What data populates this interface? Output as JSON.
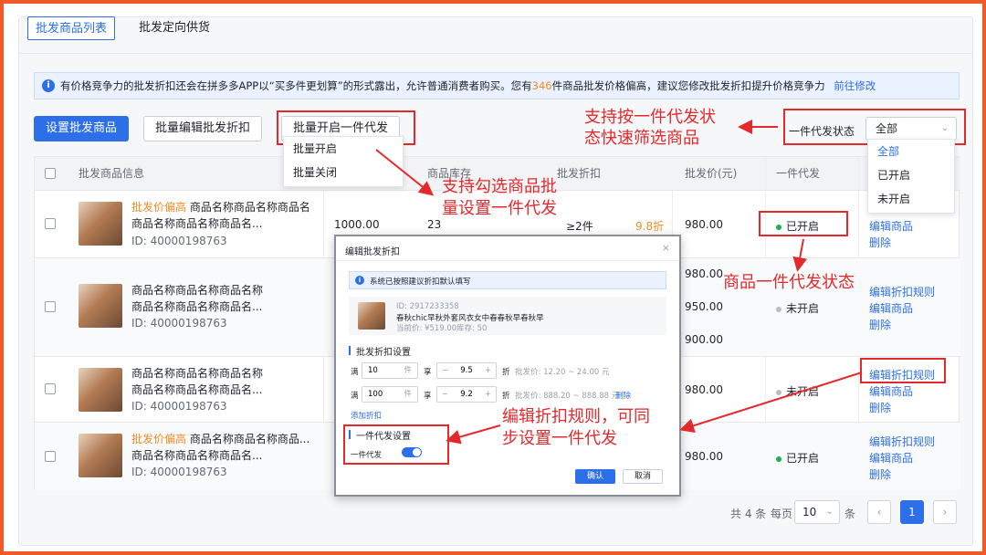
{
  "tabs": [
    {
      "label": "批发商品列表",
      "active": true
    },
    {
      "label": "批发定向供货",
      "active": false
    }
  ],
  "notice": {
    "icon": "info-icon",
    "text_before": "有价格竞争力的批发折扣还会在拼多多APP以“买多件更划算”的形式露出，允许普通消费者购买。您有",
    "count": "346",
    "text_after": "件商品批发价格偏高，建议您修改批发折扣提升价格竞争力",
    "link": "前往修改"
  },
  "toolbar": {
    "set_wholesale": "设置批发商品",
    "batch_edit": "批量编辑批发折扣",
    "batch_dropship": "批量开启一件代发",
    "dropdown": [
      "批量开启",
      "批量关闭"
    ]
  },
  "filter": {
    "label": "一件代发状态",
    "value": "全部",
    "options": [
      "全部",
      "已开启",
      "未开启"
    ]
  },
  "table": {
    "headers": {
      "info": "批发商品信息",
      "stock": "商品库存",
      "discount": "批发折扣",
      "price": "批发价(元)",
      "dropship": "一件代发"
    },
    "rows": [
      {
        "tag": "批发价偏高",
        "name1": "商品名称商品名称商品名",
        "name2": "商品名称商品名称商品名...",
        "id": "ID: 40000198763",
        "price": "1000.00",
        "stock": "23",
        "discount": "≥2件",
        "discount_value": "9.8折",
        "wprice": "980.00",
        "status": "已开启",
        "actions": [
          "编辑商品",
          "删除"
        ]
      },
      {
        "tag": "",
        "name1": "商品名称商品名称商品名称",
        "name2": "商品名称商品名称商品名...",
        "id": "ID: 40000198763",
        "price": "",
        "stock": "",
        "discount": "",
        "discount_value": "",
        "wprices": [
          "980.00",
          "950.00",
          "900.00"
        ],
        "status": "未开启",
        "actions": [
          "编辑折扣规则",
          "编辑商品",
          "删除"
        ]
      },
      {
        "tag": "",
        "name1": "商品名称商品名称商品名称",
        "name2": "商品名称商品名称商品名...",
        "id": "ID: 40000198763",
        "price": "",
        "stock": "",
        "discount": "",
        "discount_value": "",
        "wprice": "980.00",
        "status": "未开启",
        "actions": [
          "编辑折扣规则",
          "编辑商品",
          "删除"
        ]
      },
      {
        "tag": "批发价偏高",
        "name1": "商品名称商品名称商品...",
        "name2": "商品名称商品名称商品名...",
        "id": "ID: 40000198763",
        "price": "",
        "stock": "",
        "discount": "",
        "discount_value": "",
        "wprice": "980.00",
        "status": "已开启",
        "actions": [
          "编辑折扣规则",
          "编辑商品",
          "删除"
        ]
      }
    ]
  },
  "modal": {
    "title": "编辑批发折扣",
    "notice": "系统已按照建议折扣默认填写",
    "product_id": "ID: 2917233358",
    "product_name": "春秋chic早秋外套风衣女中春春秋早春秋早",
    "product_price": "当前价: ¥519.00",
    "product_stock": "库存: 50",
    "section_discount": "批发折扣设置",
    "rules": [
      {
        "man": "满",
        "qty": "10",
        "unit": "件",
        "xiang": "享",
        "val": "9.5",
        "zhe": "折",
        "note": "批发价: 12.20 ~ 24.00 元",
        "del": ""
      },
      {
        "man": "满",
        "qty": "100",
        "unit": "件",
        "xiang": "享",
        "val": "9.2",
        "zhe": "折",
        "note": "批发价: 888.20 ~ 888.88 元",
        "del": "删除"
      }
    ],
    "add_rule": "添加折扣",
    "section_dropship": "一件代发设置",
    "dropship_label": "一件代发",
    "dropship_on": true,
    "confirm": "确认",
    "cancel": "取消"
  },
  "pager": {
    "total": "共 4 条",
    "per_page_label": "每页",
    "per_page": "10",
    "unit": "条",
    "current": "1"
  },
  "annotations": {
    "filter_note_1": "支持按一件代发状",
    "filter_note_2": "态快速筛选商品",
    "select_note_1": "支持勾选商品批",
    "select_note_2": "量设置一件代发",
    "status_note": "商品一件代发状态",
    "edit_note_1": "编辑折扣规则，可同",
    "edit_note_2": "步设置一件代发"
  },
  "colors": {
    "accent": "#2d6fe8",
    "annotation": "#e5282b",
    "warning": "#f28c28",
    "on": "#1fae4a"
  }
}
